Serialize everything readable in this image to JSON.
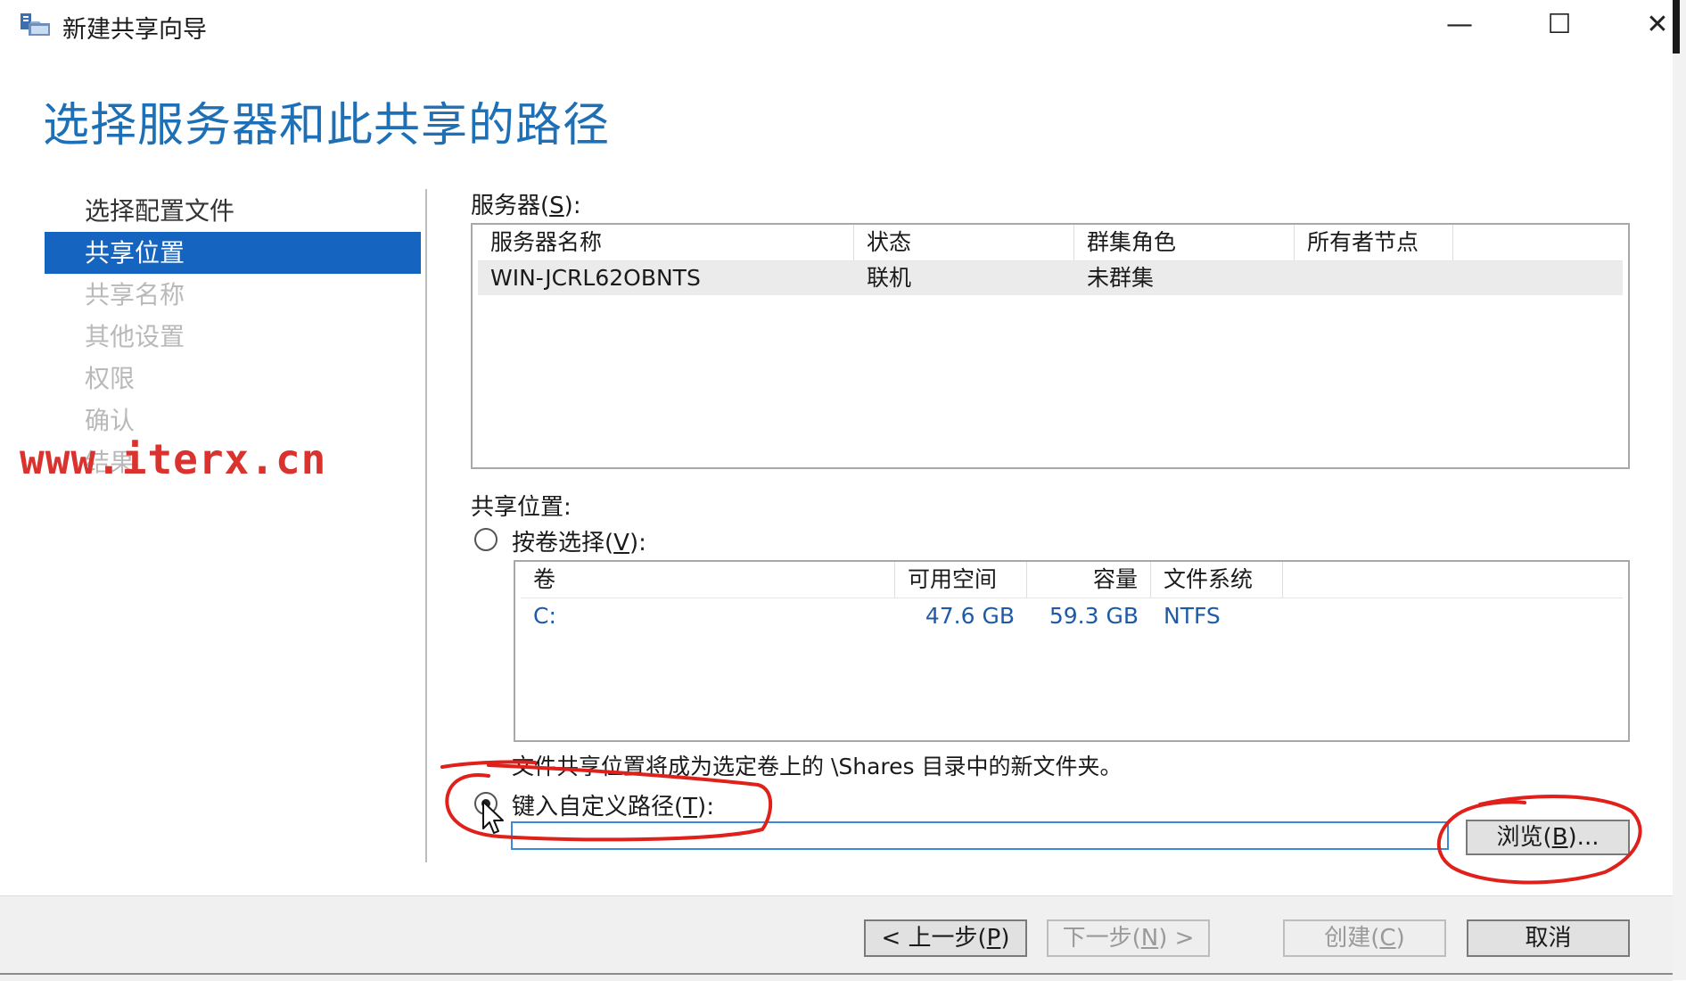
{
  "window": {
    "title": "新建共享向导",
    "minimize_glyph": "—",
    "maximize_glyph": "☐",
    "close_glyph": "✕",
    "icon": "share-wizard-icon"
  },
  "page": {
    "heading": "选择服务器和此共享的路径"
  },
  "nav": {
    "items": [
      {
        "label": "选择配置文件",
        "state": "normal"
      },
      {
        "label": "共享位置",
        "state": "active"
      },
      {
        "label": "共享名称",
        "state": "disabled"
      },
      {
        "label": "其他设置",
        "state": "disabled"
      },
      {
        "label": "权限",
        "state": "disabled"
      },
      {
        "label": "确认",
        "state": "disabled"
      },
      {
        "label": "结果",
        "state": "disabled"
      }
    ]
  },
  "watermark": "www.iterx.cn",
  "servers": {
    "label_prefix": "服务器(",
    "label_key": "S",
    "label_suffix": "):",
    "columns": [
      "服务器名称",
      "状态",
      "群集角色",
      "所有者节点"
    ],
    "rows": [
      {
        "name": "WIN-JCRL62OBNTS",
        "status": "联机",
        "cluster_role": "未群集",
        "owner_node": ""
      }
    ]
  },
  "share_location": {
    "label": "共享位置:",
    "by_volume": {
      "label_prefix": "按卷选择(",
      "label_key": "V",
      "label_suffix": "):",
      "selected": false,
      "columns": [
        "卷",
        "可用空间",
        "容量",
        "文件系统"
      ],
      "rows": [
        {
          "volume": "C:",
          "free": "47.6 GB",
          "capacity": "59.3 GB",
          "fs": "NTFS"
        }
      ],
      "note": "文件共享位置将成为选定卷上的 \\Shares 目录中的新文件夹。"
    },
    "custom_path": {
      "label_prefix": "键入自定义路径(",
      "label_key": "T",
      "label_suffix": "):",
      "selected": true,
      "value": "",
      "browse_label_prefix": "浏览(",
      "browse_key": "B",
      "browse_label_suffix": ")..."
    }
  },
  "footer": {
    "prev": {
      "prefix": "< 上一步(",
      "key": "P",
      "suffix": ")"
    },
    "next": {
      "prefix": "下一步(",
      "key": "N",
      "suffix": ") >"
    },
    "create": {
      "prefix": "创建(",
      "key": "C",
      "suffix": ")"
    },
    "cancel": "取消"
  },
  "annotation_color": "#e0201b"
}
